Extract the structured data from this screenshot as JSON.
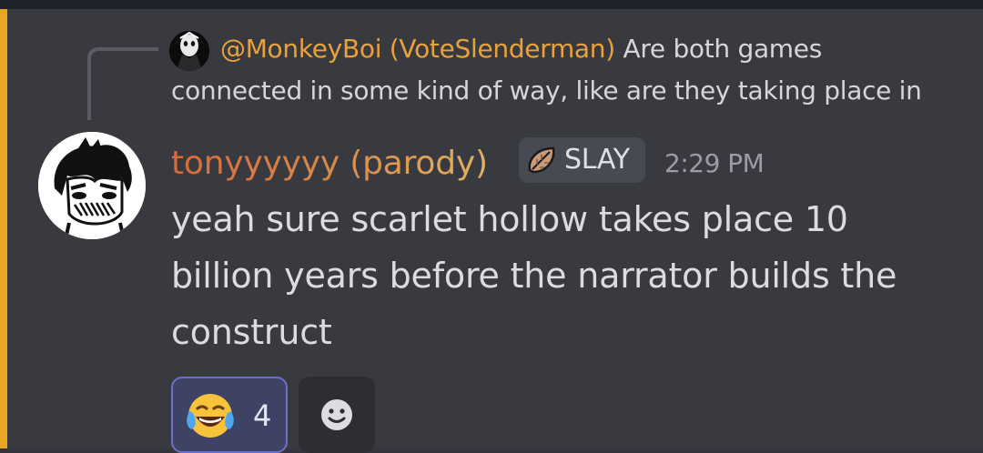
{
  "reply": {
    "author": "@MonkeyBoi (VoteSlenderman)",
    "text_line1": "Are both games",
    "text_line2": "connected in some kind of way, like are they taking place in",
    "avatar_icon": "reply-author-avatar-icon"
  },
  "message": {
    "username": "tonyyyyyy (parody)",
    "tag_label": "SLAY",
    "tag_icon": "leaf-badge-icon",
    "timestamp": "2:29 PM",
    "content": "yeah sure scarlet hollow takes place 10 billion years before the narrator builds the construct",
    "avatar_icon": "user-avatar-icon"
  },
  "reactions": [
    {
      "emoji": "face-with-tears-of-joy-icon",
      "count": "4",
      "selected": true
    }
  ],
  "add_reaction_icon": "add-reaction-icon",
  "colors": {
    "background": "#393940",
    "mention_bar": "#e7a723",
    "reply_author": "#e9a23b",
    "username_gradient_start": "#d86a3a",
    "username_gradient_end": "#e2b260",
    "reaction_selected_bg": "#3e4366",
    "reaction_selected_border": "#6b70c9"
  }
}
